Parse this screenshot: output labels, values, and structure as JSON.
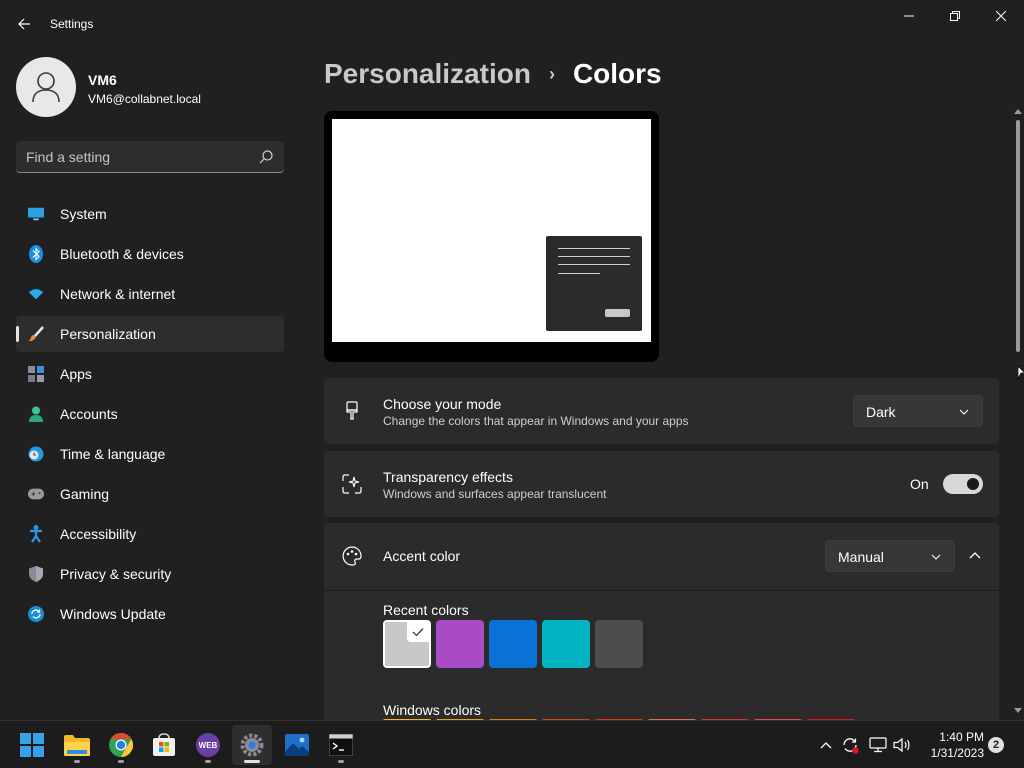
{
  "window": {
    "title": "Settings"
  },
  "profile": {
    "name": "VM6",
    "email": "VM6@collabnet.local"
  },
  "search": {
    "placeholder": "Find a setting"
  },
  "sidebar": {
    "items": [
      {
        "label": "System",
        "icon": "monitor-icon",
        "active": false
      },
      {
        "label": "Bluetooth & devices",
        "icon": "bluetooth-icon",
        "active": false
      },
      {
        "label": "Network & internet",
        "icon": "wifi-icon",
        "active": false
      },
      {
        "label": "Personalization",
        "icon": "paintbrush-icon",
        "active": true
      },
      {
        "label": "Apps",
        "icon": "apps-icon",
        "active": false
      },
      {
        "label": "Accounts",
        "icon": "person-icon",
        "active": false
      },
      {
        "label": "Time & language",
        "icon": "clock-globe-icon",
        "active": false
      },
      {
        "label": "Gaming",
        "icon": "gamepad-icon",
        "active": false
      },
      {
        "label": "Accessibility",
        "icon": "accessibility-icon",
        "active": false
      },
      {
        "label": "Privacy & security",
        "icon": "shield-icon",
        "active": false
      },
      {
        "label": "Windows Update",
        "icon": "update-icon",
        "active": false
      }
    ]
  },
  "breadcrumb": {
    "parent": "Personalization",
    "separator": "›",
    "current": "Colors"
  },
  "mode": {
    "title": "Choose your mode",
    "description": "Change the colors that appear in Windows and your apps",
    "value": "Dark"
  },
  "transparency": {
    "title": "Transparency effects",
    "description": "Windows and surfaces appear translucent",
    "state_label": "On",
    "enabled": true
  },
  "accent": {
    "title": "Accent color",
    "value": "Manual",
    "expanded": true,
    "recent_label": "Recent colors",
    "recent_colors": [
      "#c8c8c8",
      "#a84bc4",
      "#0a72d6",
      "#00b4c2",
      "#4c4c4c"
    ],
    "selected_index": 0,
    "windows_label": "Windows colors",
    "windows_colors": [
      "#ffb900",
      "#e8a415",
      "#e3770c",
      "#ca5010",
      "#da3b01",
      "#ef6950",
      "#d13438",
      "#e74856",
      "#e81123"
    ]
  },
  "taskbar": {
    "apps": [
      {
        "name": "start-button",
        "icon": "windows-logo-icon"
      },
      {
        "name": "file-explorer",
        "icon": "folder-icon"
      },
      {
        "name": "chrome",
        "icon": "chrome-icon"
      },
      {
        "name": "microsoft-store",
        "icon": "store-icon"
      },
      {
        "name": "webex",
        "icon": "webex-icon",
        "text": "WEB"
      },
      {
        "name": "settings",
        "icon": "gear-icon",
        "active": true
      },
      {
        "name": "photos",
        "icon": "photos-icon"
      },
      {
        "name": "terminal",
        "icon": "terminal-icon"
      }
    ],
    "time": "1:40 PM",
    "date": "1/31/2023",
    "notifications": "2"
  },
  "colors": {
    "background": "#202020",
    "card": "#2b2b2b",
    "taskbar": "#1c1c1c",
    "accent_blue": "#0a72d6"
  }
}
